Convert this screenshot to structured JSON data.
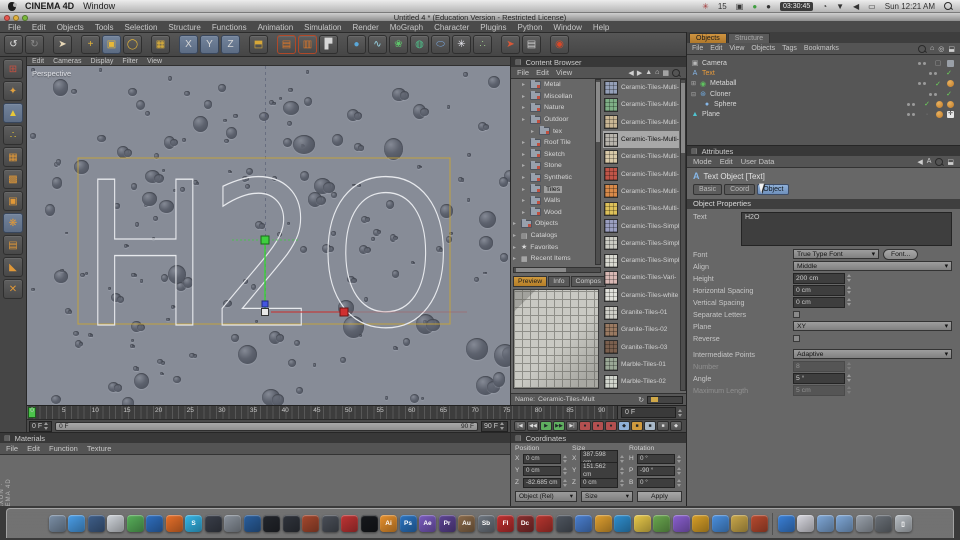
{
  "macbar": {
    "app": "CINEMA 4D",
    "menus": [
      "Window"
    ],
    "status": {
      "battery": "15",
      "timer": "03:30:45",
      "clock": "Sun 12:21 AM"
    }
  },
  "titlebar": {
    "title": "Untitled 4 * (Education Version - Restricted License)"
  },
  "menubar": {
    "items": [
      "File",
      "Edit",
      "Objects",
      "Tools",
      "Selection",
      "Structure",
      "Functions",
      "Animation",
      "Simulation",
      "Render",
      "MoGraph",
      "Character",
      "Plugins",
      "Python",
      "Window",
      "Help"
    ]
  },
  "toolbar": {
    "icons": [
      {
        "n": "undo-icon",
        "g": "↺",
        "fg": "#e0e0e0"
      },
      {
        "n": "redo-icon",
        "g": "↻",
        "fg": "#8a8a8a"
      },
      {
        "n": "select-tool-icon",
        "g": "➤",
        "fg": "#e8d8b8",
        "gap": true
      },
      {
        "n": "move-tool-icon",
        "g": "+",
        "fg": "#e8b838",
        "gap": true
      },
      {
        "n": "scale-tool-icon",
        "g": "▣",
        "fg": "#e8b838",
        "sel": true
      },
      {
        "n": "rotate-tool-icon",
        "g": "◯",
        "fg": "#e8b838"
      },
      {
        "n": "last-tool-icon",
        "g": "▦",
        "fg": "#e8b838",
        "gap": true
      },
      {
        "n": "lock-x-icon",
        "g": "X",
        "fg": "#d8d8d8",
        "sel": true,
        "gap": true
      },
      {
        "n": "lock-y-icon",
        "g": "Y",
        "fg": "#d8d8d8",
        "sel": true
      },
      {
        "n": "lock-z-icon",
        "g": "Z",
        "fg": "#d8d8d8",
        "sel": true
      },
      {
        "n": "coord-system-icon",
        "g": "⬒",
        "fg": "#d8a838",
        "gap": true
      },
      {
        "n": "render-view-icon",
        "g": "▤",
        "fg": "#e07828",
        "gap": true,
        "bd": "#b04828"
      },
      {
        "n": "render-region-icon",
        "g": "▥",
        "fg": "#e07828",
        "bd": "#b04828"
      },
      {
        "n": "render-settings-icon",
        "g": "▛",
        "fg": "#d8d8d8"
      },
      {
        "n": "add-primitive-icon",
        "g": "●",
        "fg": "#5aa7d8",
        "gap": true
      },
      {
        "n": "add-spline-icon",
        "g": "∿",
        "fg": "#9ad8e8"
      },
      {
        "n": "mograph-icon",
        "g": "❀",
        "fg": "#5ec46a"
      },
      {
        "n": "deformer-icon",
        "g": "◍",
        "fg": "#4ec08a"
      },
      {
        "n": "environment-icon",
        "g": "⬭",
        "fg": "#7aa8e0"
      },
      {
        "n": "particles-icon",
        "g": "✳",
        "fg": "#e8e8f0"
      },
      {
        "n": "simulation-icon",
        "g": "∴",
        "fg": "#9ac48a"
      },
      {
        "n": "axis-mode-icon",
        "g": "➤",
        "fg": "#d85838",
        "gap": true
      },
      {
        "n": "layout-icon",
        "g": "▤",
        "fg": "#d0d0d0"
      },
      {
        "n": "record-icon",
        "g": "◉",
        "fg": "#d84828",
        "gap": true
      }
    ]
  },
  "side_toolbar": {
    "icons": [
      {
        "n": "viewport-layout-icon",
        "g": "⊞",
        "fg": "#c85040"
      },
      {
        "n": "model-mode-icon",
        "g": "✦",
        "fg": "#e0a040"
      },
      {
        "n": "use-model-tool-icon",
        "g": "▲",
        "fg": "#e8c838",
        "sel": true
      },
      {
        "n": "points-mode-icon",
        "g": "∴",
        "fg": "#e8c838"
      },
      {
        "n": "edges-mode-icon",
        "g": "▦",
        "fg": "#e09838"
      },
      {
        "n": "polygons-mode-icon",
        "g": "▩",
        "fg": "#e09838"
      },
      {
        "n": "faces-mode-icon",
        "g": "▣",
        "fg": "#e09838"
      },
      {
        "n": "texture-mode-icon",
        "g": "❋",
        "fg": "#e09838",
        "sel": true
      },
      {
        "n": "texture-axis-icon",
        "g": "▤",
        "fg": "#e09838"
      },
      {
        "n": "workplane-icon",
        "g": "◣",
        "fg": "#e09838"
      },
      {
        "n": "snap-icon",
        "g": "✕",
        "fg": "#e09838"
      }
    ]
  },
  "viewport": {
    "menu": [
      "Edit",
      "Cameras",
      "Display",
      "Filter",
      "View"
    ],
    "label": "Perspective",
    "text": "H2O"
  },
  "timeline": {
    "ticks": [
      0,
      5,
      10,
      15,
      20,
      25,
      30,
      35,
      40,
      45,
      50,
      55,
      60,
      65,
      70,
      75,
      80,
      85,
      90
    ],
    "current": "0 F",
    "range_start": "0 F",
    "range_end": "90 F",
    "end": "90 F"
  },
  "transport": {
    "buttons": [
      {
        "n": "goto-start-button",
        "g": "|◀"
      },
      {
        "n": "prev-key-button",
        "g": "◀◀"
      },
      {
        "n": "play-button",
        "g": "▶",
        "bg": "#5fae5f"
      },
      {
        "n": "play-forward-button",
        "g": "▶▶",
        "bg": "#5fae5f"
      },
      {
        "n": "goto-end-button",
        "g": "▶|"
      },
      {
        "n": "record-position-button",
        "g": "●",
        "bg": "#b35050"
      },
      {
        "n": "record-scale-button",
        "g": "●",
        "bg": "#b35050"
      },
      {
        "n": "record-rotation-button",
        "g": "●",
        "bg": "#b35050"
      },
      {
        "n": "autokey-button",
        "g": "◆",
        "bg": "#8fb0d8"
      },
      {
        "n": "keyframe-button",
        "g": "■",
        "bg": "#d09a3e"
      },
      {
        "n": "key-param-button",
        "g": "■",
        "bg": "#a8b8c8"
      },
      {
        "n": "key-pla-button",
        "g": "■"
      },
      {
        "n": "solo-button",
        "g": "◆"
      }
    ]
  },
  "materials": {
    "title": "Materials",
    "menu": [
      "File",
      "Edit",
      "Function",
      "Texture"
    ]
  },
  "brand": {
    "line1": "MAXON",
    "line2": "CINEMA 4D"
  },
  "content_browser": {
    "title": "Content Browser",
    "menu": [
      "File",
      "Edit",
      "View"
    ],
    "icons": [
      {
        "n": "back-icon",
        "g": "◀"
      },
      {
        "n": "forward-icon",
        "g": "▶"
      },
      {
        "n": "up-icon",
        "g": "▲"
      },
      {
        "n": "home-icon",
        "g": "⌂"
      },
      {
        "n": "grid-view-icon",
        "g": "▦"
      },
      {
        "n": "search-icon",
        "g": "lens"
      }
    ],
    "tree": [
      {
        "label": "Metal",
        "depth": 1
      },
      {
        "label": "Miscellan",
        "depth": 1
      },
      {
        "label": "Nature",
        "depth": 1
      },
      {
        "label": "Outdoor",
        "depth": 1
      },
      {
        "label": "tex",
        "depth": 2
      },
      {
        "label": "Roof Tile",
        "depth": 1
      },
      {
        "label": "Sketch",
        "depth": 1
      },
      {
        "label": "Stone",
        "depth": 1
      },
      {
        "label": "Synthetic",
        "depth": 1
      },
      {
        "label": "Tiles",
        "depth": 1,
        "selected": true
      },
      {
        "label": "Walls",
        "depth": 1
      },
      {
        "label": "Wood",
        "depth": 1
      },
      {
        "label": "Objects",
        "depth": 0
      },
      {
        "label": "Catalogs",
        "depth": 0,
        "icon": "catalog"
      },
      {
        "label": "Favorites",
        "depth": 0,
        "icon": "star"
      },
      {
        "label": "Recent Items",
        "depth": 0,
        "icon": "recent"
      }
    ],
    "tabs": [
      {
        "label": "Preview",
        "selected": true
      },
      {
        "label": "Info"
      },
      {
        "label": "Compos"
      }
    ],
    "items": [
      {
        "label": "Ceramic-Tiles-Multi-",
        "color": "#95a0b8"
      },
      {
        "label": "Ceramic-Tiles-Multi-",
        "color": "#7fae86"
      },
      {
        "label": "Ceramic-Tiles-Multi-",
        "color": "#c9b694"
      },
      {
        "label": "Ceramic-Tiles-Multi-",
        "color": "#b8b4ac",
        "selected": true
      },
      {
        "label": "Ceramic-Tiles-Multi-",
        "color": "#d8c9a8"
      },
      {
        "label": "Ceramic-Tiles-Multi-",
        "color": "#c05548"
      },
      {
        "label": "Ceramic-Tiles-Multi-",
        "color": "#d88a4a"
      },
      {
        "label": "Ceramic-Tiles-Multi-",
        "color": "#ddc15a"
      },
      {
        "label": "Ceramic-Tiles-Simpl",
        "color": "#9a9ec0"
      },
      {
        "label": "Ceramic-Tiles-Simpl",
        "color": "#ccccc4"
      },
      {
        "label": "Ceramic-Tiles-Simpl",
        "color": "#d8d8d0"
      },
      {
        "label": "Ceramic-Tiles-Vari-",
        "color": "#d8b8b4"
      },
      {
        "label": "Ceramic-Tiles-white",
        "color": "#e0e0da"
      },
      {
        "label": "Granite-Tiles-01",
        "color": "#cfcfc8"
      },
      {
        "label": "Granite-Tiles-02",
        "color": "#9a7a62"
      },
      {
        "label": "Granite-Tiles-03",
        "color": "#7a5f4e"
      },
      {
        "label": "Marble-Tiles-01",
        "color": "#9aa896"
      },
      {
        "label": "Marble-Tiles-02",
        "color": "#d0d4cc"
      }
    ],
    "name_label": "Name:",
    "name_value": "Ceramic-Tiles-Mult"
  },
  "objects_panel": {
    "tabs": [
      {
        "label": "Objects",
        "selected": true
      },
      {
        "label": "Structure"
      }
    ],
    "menu": [
      "File",
      "Edit",
      "View",
      "Objects",
      "Tags",
      "Bookmarks"
    ],
    "icons": [
      {
        "n": "search-icon",
        "g": "lens"
      },
      {
        "n": "home-icon",
        "g": "⌂"
      },
      {
        "n": "filter-icon",
        "g": "◎"
      },
      {
        "n": "bookmark-icon",
        "g": "⬓"
      }
    ],
    "items": [
      {
        "label": "Camera",
        "icon": "▣",
        "ic": "#b8b8b8",
        "check": "box",
        "tags": [
          "sq"
        ]
      },
      {
        "label": "Text",
        "icon": "A",
        "ic": "#86b7e8",
        "selected": true,
        "check": "on"
      },
      {
        "label": "Metaball",
        "icon": "◉",
        "ic": "#5fc45f",
        "exp": "+",
        "check": "on",
        "tags": [
          "tex"
        ]
      },
      {
        "label": "Cloner",
        "icon": "⊛",
        "ic": "#6fa8dc",
        "exp": "-",
        "check": "on"
      },
      {
        "label": "Sphere",
        "icon": "●",
        "ic": "#86b7e8",
        "child": true,
        "check": "on",
        "tags": [
          "tex",
          "tex"
        ]
      },
      {
        "label": "Plane",
        "icon": "▲",
        "ic": "#4fc3cf",
        "check": "off",
        "tags": [
          "tex",
          "axis"
        ]
      }
    ]
  },
  "attributes": {
    "title": "Attributes",
    "menu": [
      "Mode",
      "Edit",
      "User Data"
    ],
    "icons": [
      {
        "n": "back-icon",
        "g": "◀"
      },
      {
        "n": "text-object-icon",
        "g": "A"
      },
      {
        "n": "search-icon",
        "g": "lens"
      },
      {
        "n": "lock-icon",
        "g": "⬓"
      }
    ],
    "object_header": "Text Object [Text]",
    "tabs": [
      {
        "label": "Basic"
      },
      {
        "label": "Coord"
      },
      {
        "label": "Object",
        "selected": true
      }
    ],
    "section": "Object Properties",
    "text_label": "Text",
    "text_value": "H2O",
    "rows": [
      {
        "label": "Font",
        "type": "font",
        "value": "True Type Font",
        "button": "Font..."
      },
      {
        "label": "Align",
        "type": "select",
        "value": "Middle"
      },
      {
        "label": "Height",
        "type": "spin",
        "value": "200 cm"
      },
      {
        "label": "Horizontal Spacing",
        "type": "spin",
        "value": "0 cm"
      },
      {
        "label": "Vertical Spacing",
        "type": "spin",
        "value": "0 cm"
      },
      {
        "label": "Separate Letters",
        "type": "check",
        "value": false
      },
      {
        "label": "Plane",
        "type": "select",
        "value": "XY"
      },
      {
        "label": "Reverse",
        "type": "check",
        "value": false
      },
      {
        "label": "Intermediate Points",
        "type": "select",
        "value": "Adaptive",
        "gap": true
      },
      {
        "label": "Number",
        "type": "spin",
        "value": "8",
        "disabled": true
      },
      {
        "label": "Angle",
        "type": "spin",
        "value": "5 °"
      },
      {
        "label": "Maximum Length",
        "type": "spin",
        "value": "5 cm",
        "disabled": true
      }
    ]
  },
  "coordinates": {
    "title": "Coordinates",
    "groups": [
      {
        "header": "Position",
        "rows": [
          [
            "X",
            "0 cm"
          ],
          [
            "Y",
            "0 cm"
          ],
          [
            "Z",
            "-82.685 cm"
          ]
        ]
      },
      {
        "header": "Size",
        "rows": [
          [
            "X",
            "387.598 cm"
          ],
          [
            "Y",
            "151.562 cm"
          ],
          [
            "Z",
            "0 cm"
          ]
        ]
      },
      {
        "header": "Rotation",
        "rows": [
          [
            "H",
            "0 °"
          ],
          [
            "P",
            "-90 °"
          ],
          [
            "B",
            "0 °"
          ]
        ]
      }
    ],
    "controls": {
      "left": "Object (Rel)",
      "mid": "Size",
      "apply": "Apply"
    }
  },
  "dock": {
    "icons": [
      {
        "c": "#7b8fa6"
      },
      {
        "c": "#4a9ee8"
      },
      {
        "c": "#3f5f8a"
      },
      {
        "c": "#cfd4da"
      },
      {
        "c": "#58b05a"
      },
      {
        "c": "#2f6fc0"
      },
      {
        "c": "#e8702a"
      },
      {
        "c": "#35b6e8",
        "t": "S"
      },
      {
        "c": "#3a3f4a"
      },
      {
        "c": "#8a929c"
      },
      {
        "c": "#2a5f9e"
      },
      {
        "c": "#23262c"
      },
      {
        "c": "#30343c"
      },
      {
        "c": "#a5482e"
      },
      {
        "c": "#4a4f58"
      },
      {
        "c": "#c03434"
      },
      {
        "c": "#16181c"
      },
      {
        "c": "#e8912d",
        "t": "Ai"
      },
      {
        "c": "#2b74c2",
        "t": "Ps"
      },
      {
        "c": "#7a5bbf",
        "t": "Ae"
      },
      {
        "c": "#5d4494",
        "t": "Pr"
      },
      {
        "c": "#8a6a4a",
        "t": "Au"
      },
      {
        "c": "#6e7680",
        "t": "Sb"
      },
      {
        "c": "#c03030",
        "t": "Fl"
      },
      {
        "c": "#8a2f2f",
        "t": "Dc"
      },
      {
        "c": "#b8352f"
      },
      {
        "c": "#4f5660"
      },
      {
        "c": "#4a7fd0"
      },
      {
        "c": "#e0a030"
      },
      {
        "c": "#2f8fd0"
      },
      {
        "c": "#e8c94a"
      },
      {
        "c": "#6aa84f"
      },
      {
        "c": "#8a5fd0"
      },
      {
        "c": "#d8a028"
      },
      {
        "c": "#4a90e0"
      },
      {
        "c": "#caa84a"
      },
      {
        "c": "#b84a2f"
      },
      {
        "c": "#3a80d8",
        "sep": true
      },
      {
        "c": "#d8d8e0"
      },
      {
        "c": "#7fa8d8"
      },
      {
        "c": "#7fa8d8"
      },
      {
        "c": "#9aa2ac"
      },
      {
        "c": "#6a7077"
      },
      {
        "c": "#b8bec4",
        "t": "▯"
      }
    ]
  }
}
